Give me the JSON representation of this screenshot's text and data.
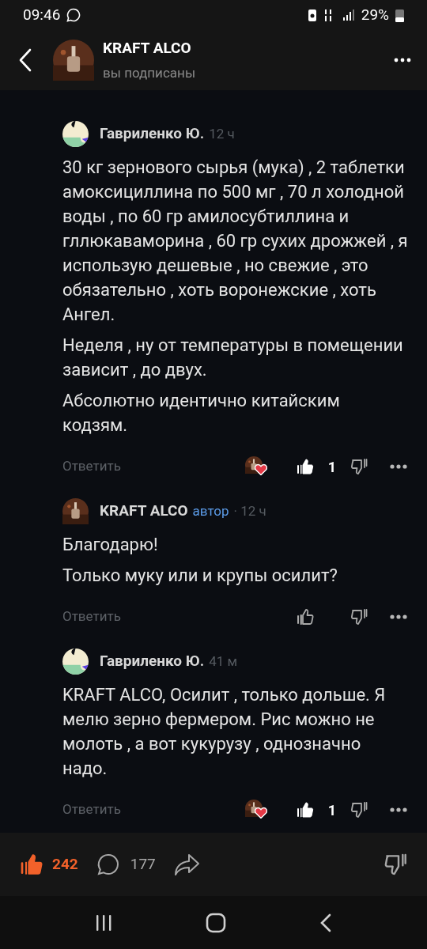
{
  "status_bar": {
    "time": "09:46",
    "battery": "29%"
  },
  "header": {
    "title": "KRAFT ALCO",
    "subtitle": "вы подписаны"
  },
  "comments": [
    {
      "kind": "reader",
      "author": "Гавриленко Ю.",
      "time": "12 ч",
      "paragraphs": [
        "30 кг зернового сырья (мука) , 2 таблетки амоксициллина по 500 мг , 70 л холодной воды , по 60 гр амилосубтиллина и гллюкаваморина , 60 гр сухих дрожжей , я использую дешевые , но свежие , это обязательно , хоть воронежские , хоть Ангел.",
        "Неделя , ну от температуры в помещении зависит , до двух.",
        "Абсолютно идентично китайским кодзям."
      ],
      "reply": "Ответить",
      "author_liked": true,
      "liked": true,
      "likes": "1"
    },
    {
      "kind": "author",
      "author": "KRAFT ALCO",
      "badge": "автор",
      "time": "· 12 ч",
      "paragraphs": [
        "Благодарю!",
        "Только муку или и крупы осилит?"
      ],
      "reply": "Ответить",
      "author_liked": false,
      "liked": false
    },
    {
      "kind": "reader",
      "author": "Гавриленко Ю.",
      "time": "41 м",
      "paragraphs": [
        "KRAFT ALCO, Осилит , только дольше. Я мелю зерно фермером. Рис можно не молоть , а вот кукурузу , однозначно надо."
      ],
      "reply": "Ответить",
      "author_liked": true,
      "liked": true,
      "likes": "1"
    }
  ],
  "bottom_bar": {
    "liked": true,
    "likes": "242",
    "comments": "177"
  }
}
